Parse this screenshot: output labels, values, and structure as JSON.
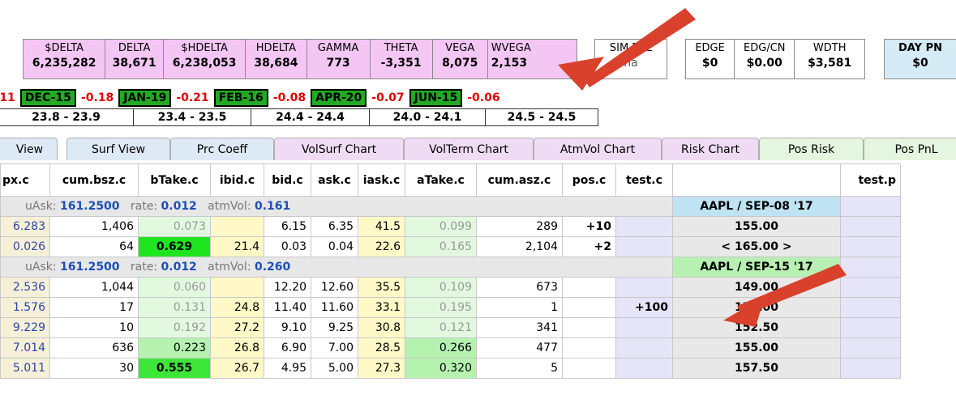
{
  "summary": {
    "pink": [
      {
        "label": "$DELTA",
        "value": "6,235,282"
      },
      {
        "label": "DELTA",
        "value": "38,671"
      },
      {
        "label": "$HDELTA",
        "value": "6,238,053"
      },
      {
        "label": "HDELTA",
        "value": "38,684"
      },
      {
        "label": "GAMMA",
        "value": "773"
      },
      {
        "label": "THETA",
        "value": "-3,351"
      },
      {
        "label": "VEGA",
        "value": "8,075"
      },
      {
        "label": "WVEGA",
        "value": "2,153"
      }
    ],
    "sim": {
      "label": "SIM PNL",
      "value": "na"
    },
    "edge": [
      {
        "label": "EDGE",
        "value": "$0"
      },
      {
        "label": "EDG/CN",
        "value": "$0.00"
      },
      {
        "label": "WDTH",
        "value": "$3,581"
      }
    ],
    "day": {
      "label": "DAY PN",
      "value": "$0"
    }
  },
  "expiries": {
    "lead": ".11",
    "items": [
      {
        "name": "DEC-15",
        "change": "-0.18",
        "range": "23.8 - 23.9"
      },
      {
        "name": "JAN-19",
        "change": "-0.21",
        "range": "23.4 - 23.5"
      },
      {
        "name": "FEB-16",
        "change": "-0.08",
        "range": "24.4 - 24.4"
      },
      {
        "name": "APR-20",
        "change": "-0.07",
        "range": "24.0 - 24.1"
      },
      {
        "name": "JUN-15",
        "change": "-0.06",
        "range": "24.5 - 24.5"
      }
    ]
  },
  "tabs": [
    "View",
    "Surf View",
    "Prc Coeff",
    "VolSurf Chart",
    "VolTerm Chart",
    "AtmVol Chart",
    "Risk Chart",
    "Pos Risk",
    "Pos PnL"
  ],
  "columns": [
    "px.c",
    "cum.bsz.c",
    "bTake.c",
    "ibid.c",
    "bid.c",
    "ask.c",
    "iask.c",
    "aTake.c",
    "cum.asz.c",
    "pos.c",
    "test.c",
    "",
    "test.p"
  ],
  "groups": [
    {
      "info": {
        "uask_label": "uAsk:",
        "uask": "161.2500",
        "rate_label": "rate:",
        "rate": "0.012",
        "vol_label": "atmVol:",
        "vol": "0.161"
      },
      "title": "AAPL / SEP-08 '17",
      "rows": [
        {
          "px": "6.283",
          "cumb": "1,406",
          "btake": "0.073",
          "ibid": "",
          "bid": "6.15",
          "ask": "6.35",
          "iask": "41.5",
          "atake": "0.099",
          "cuma": "289",
          "pos": "+10",
          "test": "",
          "strike": "155.00"
        },
        {
          "px": "0.026",
          "cumb": "64",
          "btake": "0.629",
          "ibid": "21.4",
          "bid": "0.03",
          "ask": "0.04",
          "iask": "22.6",
          "atake": "0.165",
          "cuma": "2,104",
          "pos": "+2",
          "test": "",
          "strike": "< 165.00 >"
        }
      ]
    },
    {
      "info": {
        "uask_label": "uAsk:",
        "uask": "161.2500",
        "rate_label": "rate:",
        "rate": "0.012",
        "vol_label": "atmVol:",
        "vol": "0.260"
      },
      "title": "AAPL / SEP-15 '17",
      "rows": [
        {
          "px": "2.536",
          "cumb": "1,044",
          "btake": "0.060",
          "ibid": "",
          "bid": "12.20",
          "ask": "12.60",
          "iask": "35.5",
          "atake": "0.109",
          "cuma": "673",
          "pos": "",
          "test": "",
          "strike": "149.00"
        },
        {
          "px": "1.576",
          "cumb": "17",
          "btake": "0.131",
          "ibid": "24.8",
          "bid": "11.40",
          "ask": "11.60",
          "iask": "33.1",
          "atake": "0.195",
          "cuma": "1",
          "pos": "",
          "test": "+100",
          "strike": "150.00"
        },
        {
          "px": "9.229",
          "cumb": "10",
          "btake": "0.192",
          "ibid": "27.2",
          "bid": "9.10",
          "ask": "9.25",
          "iask": "30.8",
          "atake": "0.121",
          "cuma": "341",
          "pos": "",
          "test": "",
          "strike": "152.50"
        },
        {
          "px": "7.014",
          "cumb": "636",
          "btake": "0.223",
          "ibid": "26.8",
          "bid": "6.90",
          "ask": "7.00",
          "iask": "28.5",
          "atake": "0.266",
          "cuma": "477",
          "pos": "",
          "test": "",
          "strike": "155.00"
        },
        {
          "px": "5.011",
          "cumb": "30",
          "btake": "0.555",
          "ibid": "26.7",
          "bid": "4.95",
          "ask": "5.00",
          "iask": "27.3",
          "atake": "0.320",
          "cuma": "5",
          "pos": "",
          "test": "",
          "strike": "157.50"
        }
      ]
    }
  ],
  "colors": {
    "accent_green": "#1fe51f",
    "pink": "#f4c6f4",
    "arrow": "#d9412c",
    "negative": "#e00000",
    "blue_text": "#1e4fb5"
  },
  "annotations": [
    "arrow-to-wvega",
    "arrow-to-test-cell"
  ]
}
